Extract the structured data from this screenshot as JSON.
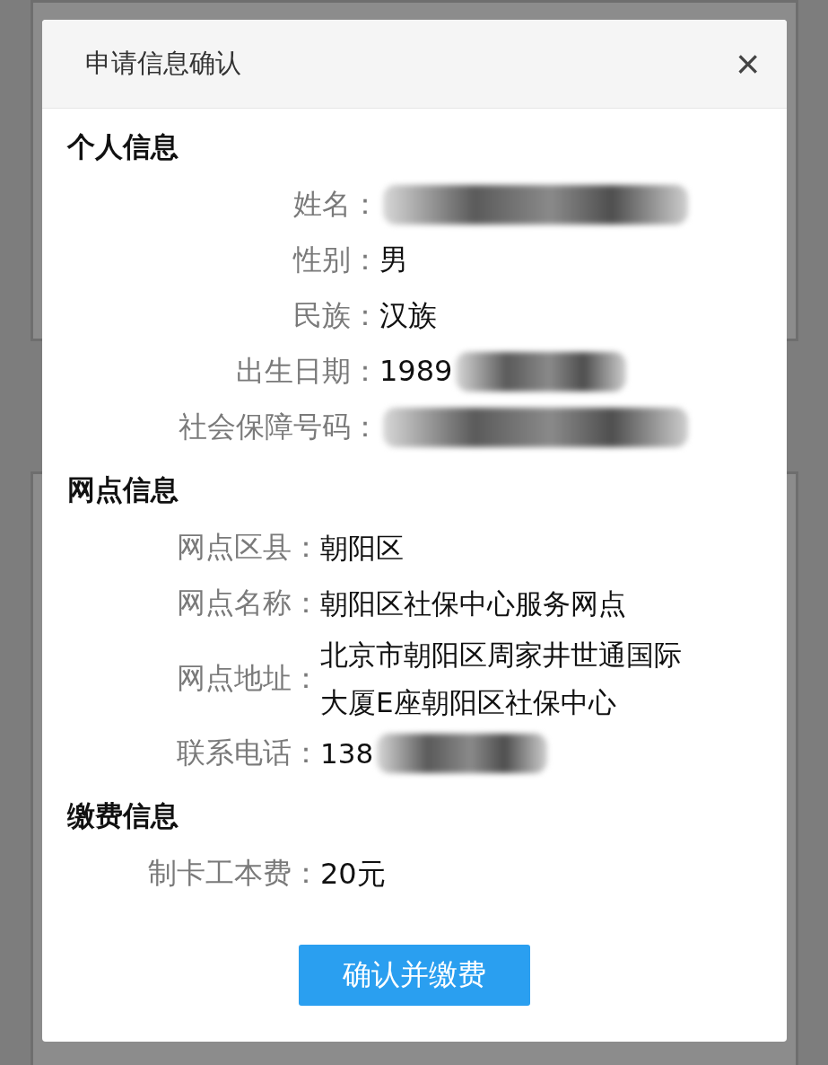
{
  "dialog": {
    "title": "申请信息确认",
    "close_label": "×"
  },
  "sections": [
    {
      "heading": "个人信息",
      "fields": [
        {
          "label": "姓名：",
          "redacted": true
        },
        {
          "label": "性别：",
          "value": "男",
          "redacted": false
        },
        {
          "label": "民族：",
          "value": "汉族",
          "redacted": false
        },
        {
          "label": "出生日期：",
          "value": "1989",
          "redacted": true
        },
        {
          "label": "社会保障号码：",
          "redacted": true
        }
      ]
    },
    {
      "heading": "网点信息",
      "fields": [
        {
          "label": "网点区县：",
          "value": "朝阳区",
          "redacted": false
        },
        {
          "label": "网点名称：",
          "value": "朝阳区社保中心服务网点",
          "redacted": false
        },
        {
          "label": "网点地址：",
          "value": "北京市朝阳区周家井世通国际大厦E座朝阳区社保中心",
          "redacted": false
        },
        {
          "label": "联系电话：",
          "value": "138",
          "redacted": true
        }
      ]
    },
    {
      "heading": "缴费信息",
      "fields": [
        {
          "label": "制卡工本费：",
          "value": "20元",
          "redacted": false
        }
      ]
    }
  ],
  "confirm_button": "确认并缴费"
}
